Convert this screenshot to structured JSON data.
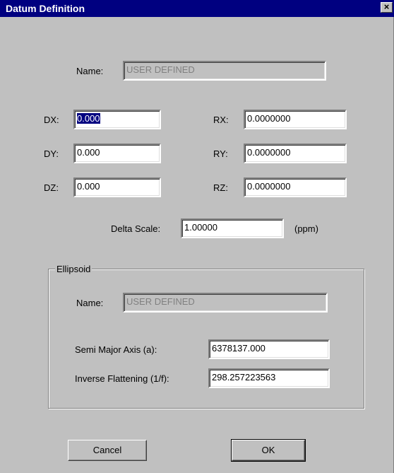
{
  "window": {
    "title": "Datum Definition",
    "close_glyph": "×"
  },
  "datum": {
    "name_label": "Name:",
    "name_value": "USER DEFINED",
    "dx_label": "DX:",
    "dx_value": "0.000",
    "dy_label": "DY:",
    "dy_value": "0.000",
    "dz_label": "DZ:",
    "dz_value": "0.000",
    "rx_label": "RX:",
    "rx_value": "0.0000000",
    "ry_label": "RY:",
    "ry_value": "0.0000000",
    "rz_label": "RZ:",
    "rz_value": "0.0000000",
    "delta_scale_label": "Delta Scale:",
    "delta_scale_value": "1.00000",
    "delta_scale_unit": "(ppm)"
  },
  "ellipsoid": {
    "group_title": "Ellipsoid",
    "name_label": "Name:",
    "name_value": "USER DEFINED",
    "semi_major_label": "Semi Major Axis (a):",
    "semi_major_value": "6378137.000",
    "inverse_flattening_label": "Inverse Flattening (1/f):",
    "inverse_flattening_value": "298.257223563"
  },
  "buttons": {
    "cancel": "Cancel",
    "ok": "OK"
  }
}
